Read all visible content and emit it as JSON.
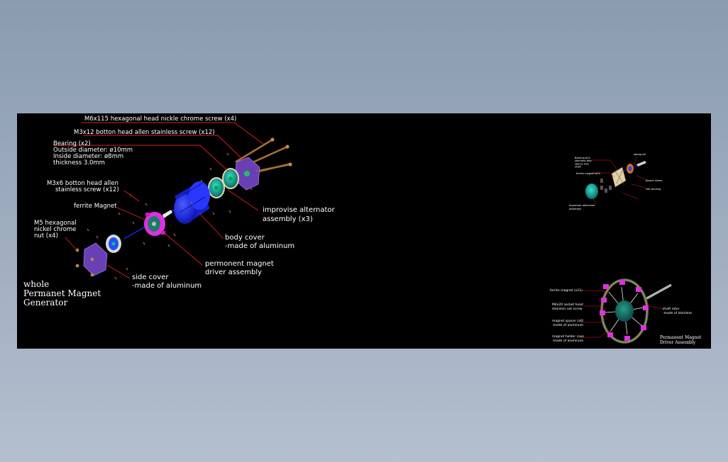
{
  "drawing": {
    "background_color": "#000000",
    "outer_background": "#93a3b6"
  },
  "main_labels": {
    "m6_screw": "M6x115 hexagonal head nickle chrome screw (x4)",
    "m3x12_screw": "M3x12 botton head allen stainless screw (x12)",
    "bearing_title": "Bearing (x2)",
    "bearing_od": "Outside diameter: ø10mm",
    "bearing_id": "Inside diameter:  ø8mm",
    "bearing_thk": "thickness    3.0mm",
    "m3x6_line1": "M3x6 botton head allen",
    "m3x6_line2": "stainless screw (x12)",
    "ferrite": "ferrite Magnet",
    "m5_line1": "M5 hexagonal",
    "m5_line2": "nickel chrome",
    "m5_line3": "nut (x4)",
    "improvise_line1": "improvise alternator",
    "improvise_line2": "assembly (x3)",
    "body_line1": "body cover",
    "body_line2": "-made of aluminum",
    "pm_driver_line1": "permonent magnet",
    "pm_driver_line2": "driver assembly",
    "side_line1": "side cover",
    "side_line2": "-made of aluminum",
    "title_line1": "whole",
    "title_line2": "Permanet Magnet",
    "title_line3": "Generator"
  },
  "detail_alternator": {
    "label_a": "Bearing ø10\nstainless disc\nspacer disc\nshaft",
    "label_b": "stamp ø3",
    "label_c": "ferrite magnet ø10",
    "label_d": "plastic wheel",
    "label_e": "coil winding",
    "label_f": "improvise alternator",
    "label_g": "assembly"
  },
  "detail_driver": {
    "ferrite": "ferrite magnet (x11)",
    "m4_line1": "M4x20 socket head",
    "m4_line2": "stainless set screw",
    "spacer_line1": "magnet spacer (x6)",
    "spacer_line2": "-made of aluminum",
    "holder_line1": "magnet holder case",
    "holder_line2": "-made of aluminum",
    "shaft_line1": "shaft rotor",
    "shaft_line2": "-made of stainless",
    "title_line1": "Permanent Magnet",
    "title_line2": "Driver Assembly"
  },
  "colors": {
    "leader": "#e02020",
    "text": "#ffffff",
    "side_cover": "#6a3fb5",
    "body_cover": "#1f2cff",
    "magnet": "#e030e0",
    "alternator": "#18b8a8",
    "screw": "#b07a3a"
  }
}
